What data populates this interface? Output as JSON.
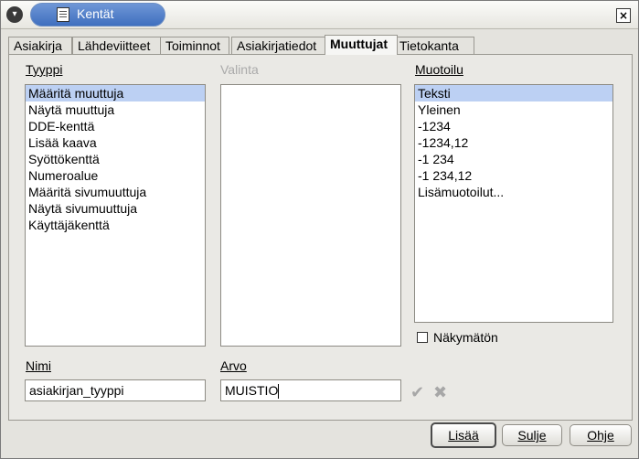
{
  "window": {
    "title": "Kentät"
  },
  "tabs": [
    {
      "label": "Asiakirja"
    },
    {
      "label": "Lähdeviitteet"
    },
    {
      "label": "Toiminnot"
    },
    {
      "label": "Asiakirjatiedot"
    },
    {
      "label": "Muuttujat"
    },
    {
      "label": "Tietokanta"
    }
  ],
  "type": {
    "label": "Tyyppi",
    "items": [
      "Määritä muuttuja",
      "Näytä muuttuja",
      "DDE-kenttä",
      "Lisää kaava",
      "Syöttökenttä",
      "Numeroalue",
      "Määritä sivumuuttuja",
      "Näytä sivumuuttuja",
      "Käyttäjäkenttä"
    ],
    "selected": "Määritä muuttuja"
  },
  "selection": {
    "label": "Valinta"
  },
  "format": {
    "label": "Muotoilu",
    "items": [
      "Teksti",
      "Yleinen",
      "-1234",
      "-1234,12",
      "-1 234",
      "-1 234,12",
      "Lisämuotoilut..."
    ],
    "selected": "Teksti"
  },
  "invisible": {
    "label": "Näkymätön"
  },
  "name": {
    "label": "Nimi",
    "value": "asiakirjan_tyyppi"
  },
  "value": {
    "label": "Arvo",
    "value": "MUISTIO"
  },
  "buttons": {
    "insert": "Lisää",
    "close": "Sulje",
    "help": "Ohje"
  },
  "icons": {
    "apply": "check-icon",
    "delete": "x-icon"
  }
}
